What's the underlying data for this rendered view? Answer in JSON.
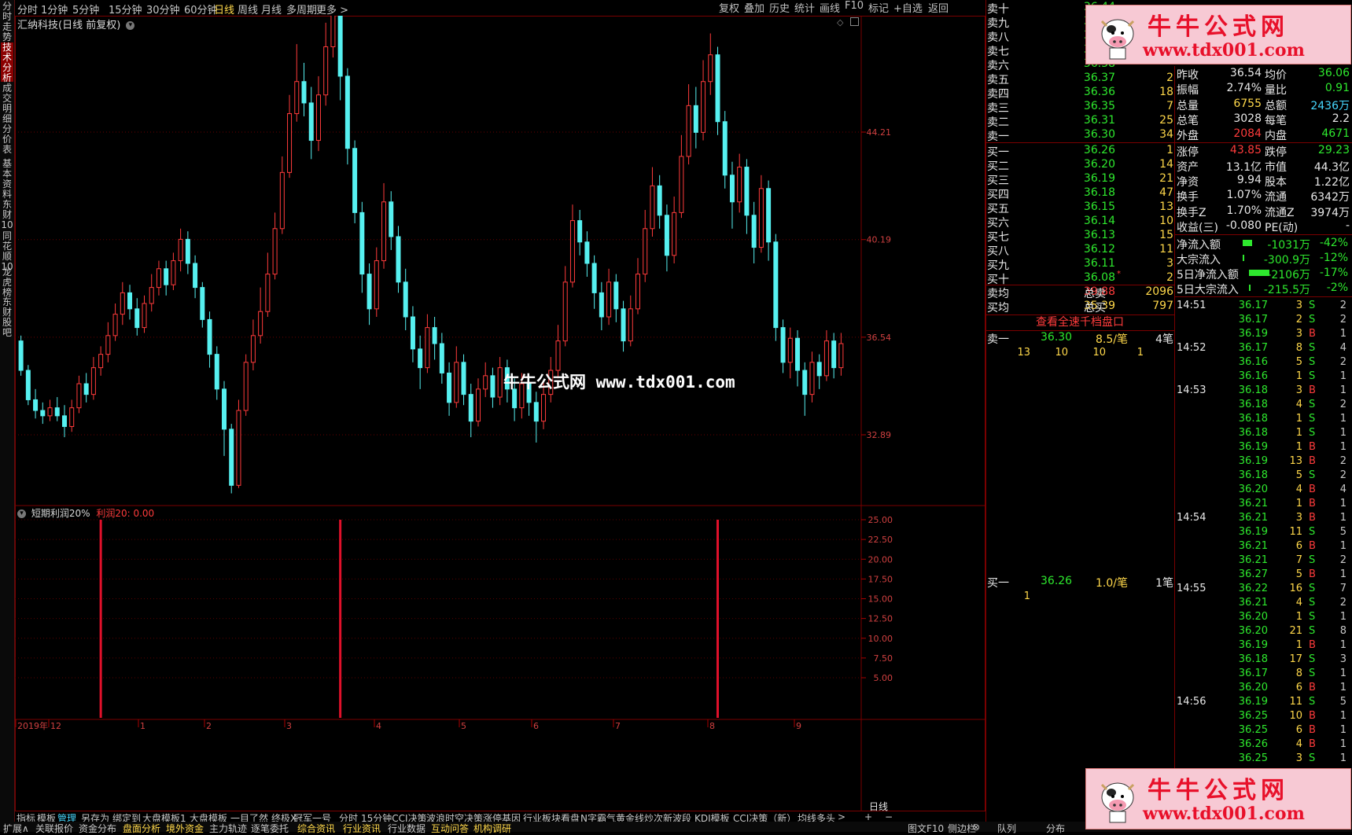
{
  "toolbar": {
    "periods": [
      "分时",
      "1分钟",
      "5分钟",
      "15分钟",
      "30分钟",
      "60分钟",
      "日线",
      "周线",
      "月线",
      "多周期",
      "更多 >"
    ],
    "active_period": "日线",
    "right_buttons": [
      "复权",
      "叠加",
      "历史",
      "统计",
      "画线",
      "F10",
      "标记",
      "+自选",
      "返回"
    ]
  },
  "left_tabs": [
    "分时走势",
    "技术分析",
    "成交明细",
    "分价表",
    "基本资料",
    "东财10",
    "同花顺10",
    "龙虎榜",
    "东财股吧"
  ],
  "chart": {
    "title": "汇纳科技(日线 前复权)",
    "price_ticks": [
      "44.21",
      "40.19",
      "36.54",
      "32.89"
    ],
    "watermark": "牛牛公式网 www.tdx001.com",
    "x_labels": [
      "2019年",
      "12",
      "1",
      "2",
      "3",
      "4",
      "5",
      "6",
      "7",
      "8",
      "9"
    ],
    "period_label": "日线",
    "up_color": "#ff3b3b",
    "down_color": "#56f0f0",
    "candles": [
      [
        36.4,
        35.3,
        36.6,
        35.1
      ],
      [
        35.3,
        34.2,
        35.5,
        34.0
      ],
      [
        34.2,
        33.8,
        34.6,
        33.5
      ],
      [
        33.8,
        33.6,
        34.1,
        33.3
      ],
      [
        33.6,
        33.9,
        34.2,
        33.4
      ],
      [
        33.9,
        33.6,
        34.3,
        33.4
      ],
      [
        33.6,
        33.2,
        34.0,
        32.8
      ],
      [
        33.2,
        33.9,
        34.2,
        33.0
      ],
      [
        33.9,
        34.8,
        35.1,
        33.7
      ],
      [
        34.8,
        34.4,
        35.2,
        34.1
      ],
      [
        34.4,
        35.4,
        35.8,
        34.2
      ],
      [
        35.4,
        35.9,
        36.2,
        35.1
      ],
      [
        35.9,
        36.6,
        37.1,
        35.6
      ],
      [
        36.6,
        37.4,
        37.8,
        36.4
      ],
      [
        37.4,
        38.2,
        38.6,
        37.0
      ],
      [
        38.2,
        37.6,
        38.5,
        37.2
      ],
      [
        37.6,
        36.9,
        38.0,
        36.6
      ],
      [
        36.9,
        37.8,
        38.1,
        36.7
      ],
      [
        37.8,
        38.4,
        38.9,
        37.5
      ],
      [
        38.4,
        39.1,
        39.4,
        38.1
      ],
      [
        39.1,
        38.5,
        39.4,
        38.1
      ],
      [
        38.5,
        39.4,
        39.7,
        38.3
      ],
      [
        39.4,
        40.2,
        40.6,
        39.0
      ],
      [
        40.2,
        39.3,
        40.5,
        38.9
      ],
      [
        39.3,
        38.4,
        39.6,
        38.0
      ],
      [
        38.4,
        37.2,
        38.6,
        36.9
      ],
      [
        37.2,
        35.9,
        37.5,
        35.4
      ],
      [
        35.9,
        34.6,
        36.2,
        34.2
      ],
      [
        34.6,
        33.1,
        34.9,
        32.1
      ],
      [
        33.1,
        31.0,
        33.3,
        30.7
      ],
      [
        31.0,
        33.8,
        34.2,
        30.9
      ],
      [
        33.8,
        35.6,
        35.9,
        33.6
      ],
      [
        35.6,
        36.6,
        37.2,
        35.3
      ],
      [
        36.6,
        37.5,
        38.4,
        36.3
      ],
      [
        37.5,
        38.9,
        39.7,
        37.3
      ],
      [
        38.9,
        40.6,
        41.2,
        38.7
      ],
      [
        40.6,
        42.7,
        43.3,
        40.4
      ],
      [
        42.7,
        44.9,
        45.6,
        42.5
      ],
      [
        44.9,
        46.1,
        47.5,
        44.6
      ],
      [
        46.1,
        45.3,
        46.8,
        44.8
      ],
      [
        45.3,
        43.9,
        45.9,
        43.2
      ],
      [
        43.9,
        45.6,
        46.3,
        43.5
      ],
      [
        45.6,
        47.4,
        48.3,
        45.2
      ],
      [
        47.4,
        48.6,
        49.9,
        47.0
      ],
      [
        48.6,
        46.3,
        48.9,
        45.4
      ],
      [
        46.3,
        43.6,
        46.6,
        43.0
      ],
      [
        43.6,
        41.2,
        43.9,
        40.8
      ],
      [
        41.2,
        38.9,
        41.6,
        38.2
      ],
      [
        38.9,
        37.6,
        39.3,
        37.0
      ],
      [
        37.6,
        39.4,
        39.9,
        37.3
      ],
      [
        39.4,
        41.6,
        42.3,
        39.1
      ],
      [
        41.6,
        40.3,
        42.0,
        39.8
      ],
      [
        40.3,
        38.6,
        40.7,
        38.2
      ],
      [
        38.6,
        37.3,
        39.1,
        36.8
      ],
      [
        37.3,
        36.1,
        37.7,
        35.6
      ],
      [
        36.1,
        35.4,
        36.6,
        34.6
      ],
      [
        35.4,
        36.9,
        37.4,
        35.2
      ],
      [
        36.9,
        36.3,
        37.3,
        35.7
      ],
      [
        36.3,
        35.2,
        36.7,
        34.8
      ],
      [
        35.2,
        34.1,
        35.6,
        33.6
      ],
      [
        34.1,
        35.6,
        36.2,
        33.9
      ],
      [
        35.6,
        34.4,
        35.9,
        34.0
      ],
      [
        34.4,
        33.4,
        34.8,
        32.8
      ],
      [
        33.4,
        34.6,
        35.0,
        33.2
      ],
      [
        34.6,
        35.1,
        35.6,
        34.3
      ],
      [
        35.1,
        34.3,
        35.4,
        33.9
      ],
      [
        34.3,
        35.4,
        35.8,
        34.0
      ],
      [
        35.4,
        34.6,
        35.7,
        34.1
      ],
      [
        34.6,
        33.9,
        35.0,
        33.4
      ],
      [
        33.9,
        34.8,
        35.2,
        33.5
      ],
      [
        34.8,
        34.1,
        35.1,
        33.6
      ],
      [
        34.1,
        33.4,
        34.5,
        32.6
      ],
      [
        33.4,
        34.4,
        34.9,
        33.1
      ],
      [
        34.4,
        35.3,
        35.8,
        34.1
      ],
      [
        35.3,
        36.4,
        37.0,
        35.0
      ],
      [
        36.4,
        38.6,
        39.2,
        36.2
      ],
      [
        38.6,
        40.9,
        41.5,
        38.4
      ],
      [
        40.9,
        40.1,
        41.3,
        39.6
      ],
      [
        40.1,
        39.3,
        40.5,
        38.8
      ],
      [
        39.3,
        38.2,
        39.6,
        37.6
      ],
      [
        38.2,
        37.3,
        38.6,
        36.8
      ],
      [
        37.3,
        38.6,
        39.1,
        37.0
      ],
      [
        38.6,
        37.6,
        38.9,
        37.1
      ],
      [
        37.6,
        36.4,
        37.9,
        36.0
      ],
      [
        36.4,
        37.6,
        38.1,
        36.2
      ],
      [
        37.6,
        38.9,
        39.5,
        37.4
      ],
      [
        38.9,
        40.6,
        41.3,
        38.6
      ],
      [
        40.6,
        42.2,
        42.9,
        40.3
      ],
      [
        42.2,
        41.1,
        42.6,
        40.6
      ],
      [
        41.1,
        39.6,
        41.5,
        39.0
      ],
      [
        39.6,
        41.2,
        41.8,
        39.3
      ],
      [
        41.2,
        43.3,
        44.1,
        41.0
      ],
      [
        43.3,
        45.2,
        46.0,
        43.0
      ],
      [
        45.2,
        44.2,
        45.9,
        43.6
      ],
      [
        44.2,
        46.1,
        46.9,
        43.9
      ],
      [
        46.1,
        47.1,
        47.9,
        45.6
      ],
      [
        47.1,
        44.6,
        47.4,
        44.1
      ],
      [
        44.6,
        42.6,
        45.0,
        42.1
      ],
      [
        42.6,
        41.6,
        43.1,
        40.6
      ],
      [
        41.6,
        42.9,
        43.4,
        41.2
      ],
      [
        42.9,
        41.1,
        43.2,
        40.4
      ],
      [
        41.1,
        39.9,
        41.6,
        39.3
      ],
      [
        39.9,
        42.1,
        42.6,
        39.7
      ],
      [
        42.1,
        40.1,
        42.4,
        39.4
      ],
      [
        40.1,
        36.9,
        40.4,
        36.4
      ],
      [
        36.9,
        35.6,
        37.2,
        35.2
      ],
      [
        35.6,
        36.5,
        36.9,
        35.0
      ],
      [
        36.5,
        35.3,
        36.8,
        34.7
      ],
      [
        35.3,
        34.4,
        35.6,
        33.6
      ],
      [
        34.4,
        35.6,
        36.0,
        34.1
      ],
      [
        35.6,
        35.1,
        35.9,
        34.6
      ],
      [
        35.1,
        36.4,
        36.8,
        34.9
      ],
      [
        36.4,
        35.4,
        36.7,
        35.0
      ],
      [
        35.4,
        36.3,
        36.7,
        35.1
      ]
    ]
  },
  "indicator": {
    "name": "短期利润20%",
    "value_label": "利润20: 0.00",
    "y_ticks": [
      "25.00",
      "22.50",
      "20.00",
      "17.50",
      "15.00",
      "12.50",
      "10.00",
      "7.50",
      "5.00"
    ],
    "signal_bars": [
      {
        "index": 11,
        "value": 25
      },
      {
        "index": 44,
        "value": 25
      },
      {
        "index": 96,
        "value": 25
      }
    ]
  },
  "bottom_tabs": [
    "指标",
    "模板",
    "管理",
    "另存为",
    "绑定到",
    "大盘模板1",
    "大盘模板",
    "一目了然",
    "终极X",
    "冠军一号",
    "分时",
    "15分钟CCI决策",
    "波浪时空决策",
    "涨停基因",
    "行业板块看盘",
    "N字霸气黄金线",
    "炒次新波段",
    "KDJ模板",
    "CCI决策（新）",
    "均线多头",
    ">",
    "+",
    "−"
  ],
  "bottom_active_tab": "管理",
  "status_tabs": [
    "扩展∧",
    "关联报价",
    "资金分布",
    "盘面分析",
    "境外资金",
    "主力轨迹",
    "逐笔委托",
    "综合资讯",
    "行业资讯",
    "行业数据",
    "互动问答",
    "机构调研"
  ],
  "status_highlight": [
    "盘面分析",
    "境外资金",
    "综合资讯",
    "行业资讯",
    "互动问答",
    "机构调研"
  ],
  "status_right": [
    "图文F10",
    "侧边栏",
    "⊗",
    "队列",
    "分布"
  ],
  "orderbook": {
    "asks": [
      {
        "label": "卖十",
        "price": "36.44",
        "vol": ""
      },
      {
        "label": "卖九",
        "price": "36.42",
        "vol": ""
      },
      {
        "label": "卖八",
        "price": "36.40",
        "vol": ""
      },
      {
        "label": "卖七",
        "price": "36.39",
        "vol": ""
      },
      {
        "label": "卖六",
        "price": "36.38",
        "vol": ""
      },
      {
        "label": "卖五",
        "price": "36.37",
        "vol": "2"
      },
      {
        "label": "卖四",
        "price": "36.36",
        "vol": "18"
      },
      {
        "label": "卖三",
        "price": "36.35",
        "vol": "7"
      },
      {
        "label": "卖二",
        "price": "36.31",
        "vol": "25"
      },
      {
        "label": "卖一",
        "price": "36.30",
        "vol": "34"
      }
    ],
    "bids": [
      {
        "label": "买一",
        "price": "36.26",
        "vol": "1"
      },
      {
        "label": "买二",
        "price": "36.20",
        "vol": "14"
      },
      {
        "label": "买三",
        "price": "36.19",
        "vol": "21"
      },
      {
        "label": "买四",
        "price": "36.18",
        "vol": "47"
      },
      {
        "label": "买五",
        "price": "36.15",
        "vol": "13"
      },
      {
        "label": "买六",
        "price": "36.14",
        "vol": "10"
      },
      {
        "label": "买七",
        "price": "36.13",
        "vol": "15"
      },
      {
        "label": "买八",
        "price": "36.12",
        "vol": "11"
      },
      {
        "label": "买九",
        "price": "36.11",
        "vol": "3"
      },
      {
        "label": "买十",
        "price": "36.08",
        "vol": "2",
        "mark": "*"
      }
    ],
    "sell_avg_label": "卖均",
    "sell_avg": "39.88",
    "total_sell_label": "总卖",
    "total_sell": "2096",
    "buy_avg_label": "买均",
    "buy_avg": "35.39",
    "total_buy_label": "总买",
    "total_buy": "797",
    "depth_link": "查看全速千档盘口",
    "ask1_detail": {
      "label": "卖一",
      "price": "36.30",
      "per": "8.5/笔",
      "count": "4笔",
      "queue": [
        "13",
        "10",
        "10",
        "1"
      ]
    },
    "bid1_detail": {
      "label": "买一",
      "price": "36.26",
      "per": "1.0/笔",
      "count": "1笔",
      "queue": [
        "1"
      ]
    }
  },
  "stats": [
    {
      "l1": "昨收",
      "v1": "36.54",
      "c1": "white",
      "l2": "均价",
      "v2": "36.06",
      "c2": "green"
    },
    {
      "l1": "振幅",
      "v1": "2.74%",
      "c1": "white",
      "l2": "量比",
      "v2": "0.91",
      "c2": "green"
    },
    {
      "l1": "总量",
      "v1": "6755",
      "c1": "yellow",
      "l2": "总额",
      "v2": "2436万",
      "c2": "cyan"
    },
    {
      "l1": "总笔",
      "v1": "3028",
      "c1": "white",
      "l2": "每笔",
      "v2": "2.2",
      "c2": "white"
    },
    {
      "l1": "外盘",
      "v1": "2084",
      "c1": "red",
      "l2": "内盘",
      "v2": "4671",
      "c2": "green"
    },
    {
      "l1": "涨停",
      "v1": "43.85",
      "c1": "red",
      "l2": "跌停",
      "v2": "29.23",
      "c2": "green"
    },
    {
      "l1": "资产",
      "v1": "13.1亿",
      "c1": "white",
      "l2": "市值",
      "v2": "44.3亿",
      "c2": "white"
    },
    {
      "l1": "净资",
      "v1": "9.94",
      "c1": "white",
      "l2": "股本",
      "v2": "1.22亿",
      "c2": "white"
    },
    {
      "l1": "换手",
      "v1": "1.07%",
      "c1": "white",
      "l2": "流通",
      "v2": "6342万",
      "c2": "white"
    },
    {
      "l1": "换手Z",
      "v1": "1.70%",
      "c1": "white",
      "l2": "流通Z",
      "v2": "3974万",
      "c2": "white"
    },
    {
      "l1": "收益(三)",
      "v1": "-0.080",
      "c1": "white",
      "l2": "PE(动)",
      "v2": "-",
      "c2": "white"
    }
  ],
  "flows": [
    {
      "label": "净流入额",
      "value": "-1031万",
      "pct": "-42%",
      "bar": 0.45
    },
    {
      "label": "大宗流入",
      "value": "-300.9万",
      "pct": "-12%",
      "bar": 0.08
    },
    {
      "label": "5日净流入额",
      "value": "-2106万",
      "pct": "-17%",
      "bar": 1.0
    },
    {
      "label": "5日大宗流入",
      "value": "-215.5万",
      "pct": "-2%",
      "bar": 0.05
    }
  ],
  "ticks": [
    {
      "t": "14:51",
      "p": "36.17",
      "v": "3",
      "s": "S",
      "n": "2"
    },
    {
      "t": "",
      "p": "36.17",
      "v": "2",
      "s": "S",
      "n": "2"
    },
    {
      "t": "",
      "p": "36.19",
      "v": "3",
      "s": "B",
      "n": "1"
    },
    {
      "t": "14:52",
      "p": "36.17",
      "v": "8",
      "s": "S",
      "n": "4"
    },
    {
      "t": "",
      "p": "36.16",
      "v": "5",
      "s": "S",
      "n": "2"
    },
    {
      "t": "",
      "p": "36.16",
      "v": "1",
      "s": "S",
      "n": "1"
    },
    {
      "t": "14:53",
      "p": "36.18",
      "v": "3",
      "s": "B",
      "n": "1"
    },
    {
      "t": "",
      "p": "36.18",
      "v": "4",
      "s": "S",
      "n": "2"
    },
    {
      "t": "",
      "p": "36.18",
      "v": "1",
      "s": "S",
      "n": "1"
    },
    {
      "t": "",
      "p": "36.18",
      "v": "1",
      "s": "S",
      "n": "1"
    },
    {
      "t": "",
      "p": "36.19",
      "v": "1",
      "s": "B",
      "n": "1"
    },
    {
      "t": "",
      "p": "36.19",
      "v": "13",
      "s": "B",
      "n": "2"
    },
    {
      "t": "",
      "p": "36.18",
      "v": "5",
      "s": "S",
      "n": "2"
    },
    {
      "t": "",
      "p": "36.20",
      "v": "4",
      "s": "B",
      "n": "4"
    },
    {
      "t": "",
      "p": "36.21",
      "v": "1",
      "s": "B",
      "n": "1"
    },
    {
      "t": "14:54",
      "p": "36.21",
      "v": "3",
      "s": "B",
      "n": "1"
    },
    {
      "t": "",
      "p": "36.19",
      "v": "11",
      "s": "S",
      "n": "5"
    },
    {
      "t": "",
      "p": "36.21",
      "v": "6",
      "s": "B",
      "n": "1"
    },
    {
      "t": "",
      "p": "36.21",
      "v": "7",
      "s": "S",
      "n": "2"
    },
    {
      "t": "",
      "p": "36.27",
      "v": "5",
      "s": "B",
      "n": "1"
    },
    {
      "t": "14:55",
      "p": "36.22",
      "v": "16",
      "s": "S",
      "n": "7"
    },
    {
      "t": "",
      "p": "36.21",
      "v": "4",
      "s": "S",
      "n": "2"
    },
    {
      "t": "",
      "p": "36.20",
      "v": "1",
      "s": "S",
      "n": "1"
    },
    {
      "t": "",
      "p": "36.20",
      "v": "21",
      "s": "S",
      "n": "8"
    },
    {
      "t": "",
      "p": "36.19",
      "v": "1",
      "s": "B",
      "n": "1"
    },
    {
      "t": "",
      "p": "36.18",
      "v": "17",
      "s": "S",
      "n": "3"
    },
    {
      "t": "",
      "p": "36.17",
      "v": "8",
      "s": "S",
      "n": "1"
    },
    {
      "t": "",
      "p": "36.20",
      "v": "6",
      "s": "B",
      "n": "1"
    },
    {
      "t": "14:56",
      "p": "36.19",
      "v": "11",
      "s": "S",
      "n": "5"
    },
    {
      "t": "",
      "p": "36.25",
      "v": "10",
      "s": "B",
      "n": "1"
    },
    {
      "t": "",
      "p": "36.25",
      "v": "6",
      "s": "B",
      "n": "1"
    },
    {
      "t": "",
      "p": "36.26",
      "v": "4",
      "s": "B",
      "n": "1"
    },
    {
      "t": "",
      "p": "36.25",
      "v": "3",
      "s": "S",
      "n": "1"
    }
  ],
  "logo": {
    "name": "牛牛公式网",
    "url": "www.tdx001.com"
  }
}
